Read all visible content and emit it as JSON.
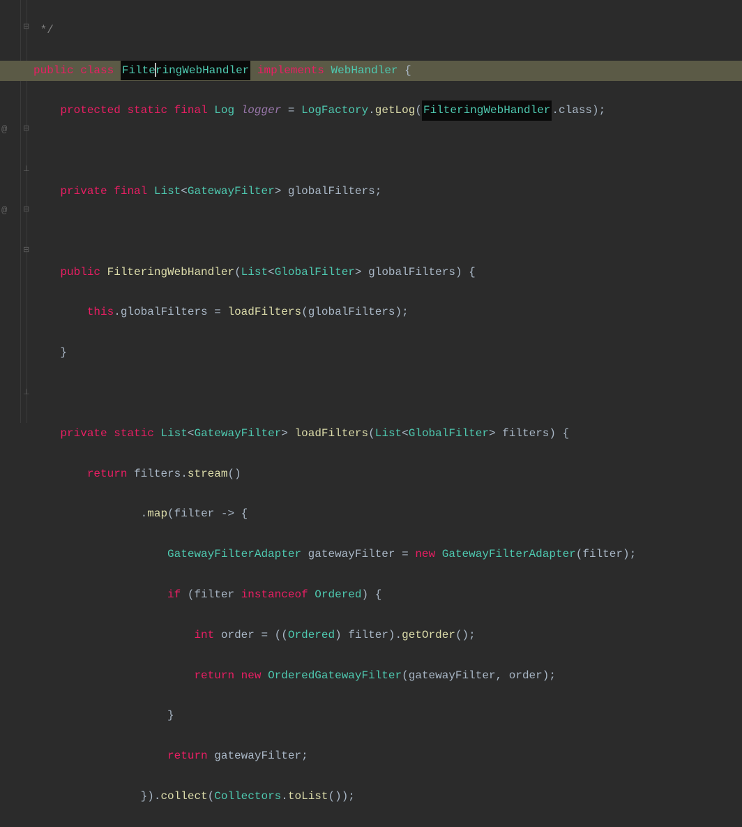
{
  "gutter": {
    "line6_annotation": "@",
    "line11_annotation": "@"
  },
  "code": {
    "l0_comment": " */",
    "l1": {
      "public": "public",
      "class": "class",
      "name": "FilteringWebHandler",
      "implements": "implements",
      "iface": "WebHandler",
      "brace": " {"
    },
    "l2": {
      "indent": "    ",
      "protected": "protected",
      "static": "static",
      "final": "final",
      "type": "Log",
      "var": "logger",
      "eq": " = ",
      "factory": "LogFactory",
      "dot": ".",
      "method": "getLog",
      "open": "(",
      "arg": "FilteringWebHandler",
      "dotclass": ".class",
      "close": ");"
    },
    "l4": {
      "indent": "    ",
      "private": "private",
      "final": "final",
      "list": "List",
      "lt": "<",
      "gtype": "GatewayFilter",
      "gt": ">",
      "name": " globalFilters;"
    },
    "l6": {
      "indent": "    ",
      "public": "public",
      "ctor": "FilteringWebHandler",
      "open": "(",
      "list": "List",
      "lt": "<",
      "gtype": "GlobalFilter",
      "gt": ">",
      "param": " globalFilters",
      "close": ") {"
    },
    "l7": {
      "indent": "        ",
      "this": "this",
      "dot": ".",
      "field": "globalFilters",
      "eq": " = ",
      "call": "loadFilters",
      "args": "(globalFilters);"
    },
    "l8": {
      "indent": "    ",
      "brace": "}"
    },
    "l10": {
      "indent": "    ",
      "private": "private",
      "static": "static",
      "list": "List",
      "lt": "<",
      "gtype": "GatewayFilter",
      "gt": ">",
      "name": " loadFilters",
      "open": "(",
      "list2": "List",
      "lt2": "<",
      "gtype2": "GlobalFilter",
      "gt2": ">",
      "param": " filters",
      "close": ") {"
    },
    "l11": {
      "indent": "        ",
      "return": "return",
      "sp": " ",
      "var": "filters",
      "dot": ".",
      "stream": "stream",
      "call": "()"
    },
    "l12": {
      "indent": "                ",
      "dot": ".",
      "map": "map",
      "open": "(",
      "param": "filter",
      "arrow": " -> {"
    },
    "l13": {
      "indent": "                    ",
      "type": "GatewayFilterAdapter",
      "sp": " ",
      "var": "gatewayFilter",
      "eq": " = ",
      "new": "new",
      "sp2": " ",
      "ctor": "GatewayFilterAdapter",
      "args": "(filter);"
    },
    "l14": {
      "indent": "                    ",
      "if": "if",
      "open": " (",
      "var": "filter",
      "sp": " ",
      "instanceof": "instanceof",
      "sp2": " ",
      "type": "Ordered",
      "close": ") {"
    },
    "l15": {
      "indent": "                        ",
      "int": "int",
      "sp": " ",
      "var": "order",
      "eq": " = ((",
      "type": "Ordered",
      "cast": ") filter).",
      "method": "getOrder",
      "call": "();"
    },
    "l16": {
      "indent": "                        ",
      "return": "return",
      "sp": " ",
      "new": "new",
      "sp2": " ",
      "type": "OrderedGatewayFilter",
      "open": "(",
      "args": "gatewayFilter, order);"
    },
    "l17": {
      "indent": "                    ",
      "brace": "}"
    },
    "l18": {
      "indent": "                    ",
      "return": "return",
      "sp": " ",
      "var": "gatewayFilter;"
    },
    "l19": {
      "indent": "                ",
      "close": "}).",
      "collect": "collect",
      "open": "(",
      "collectors": "Collectors",
      "dot": ".",
      "tolist": "toList",
      "call": "());"
    }
  }
}
